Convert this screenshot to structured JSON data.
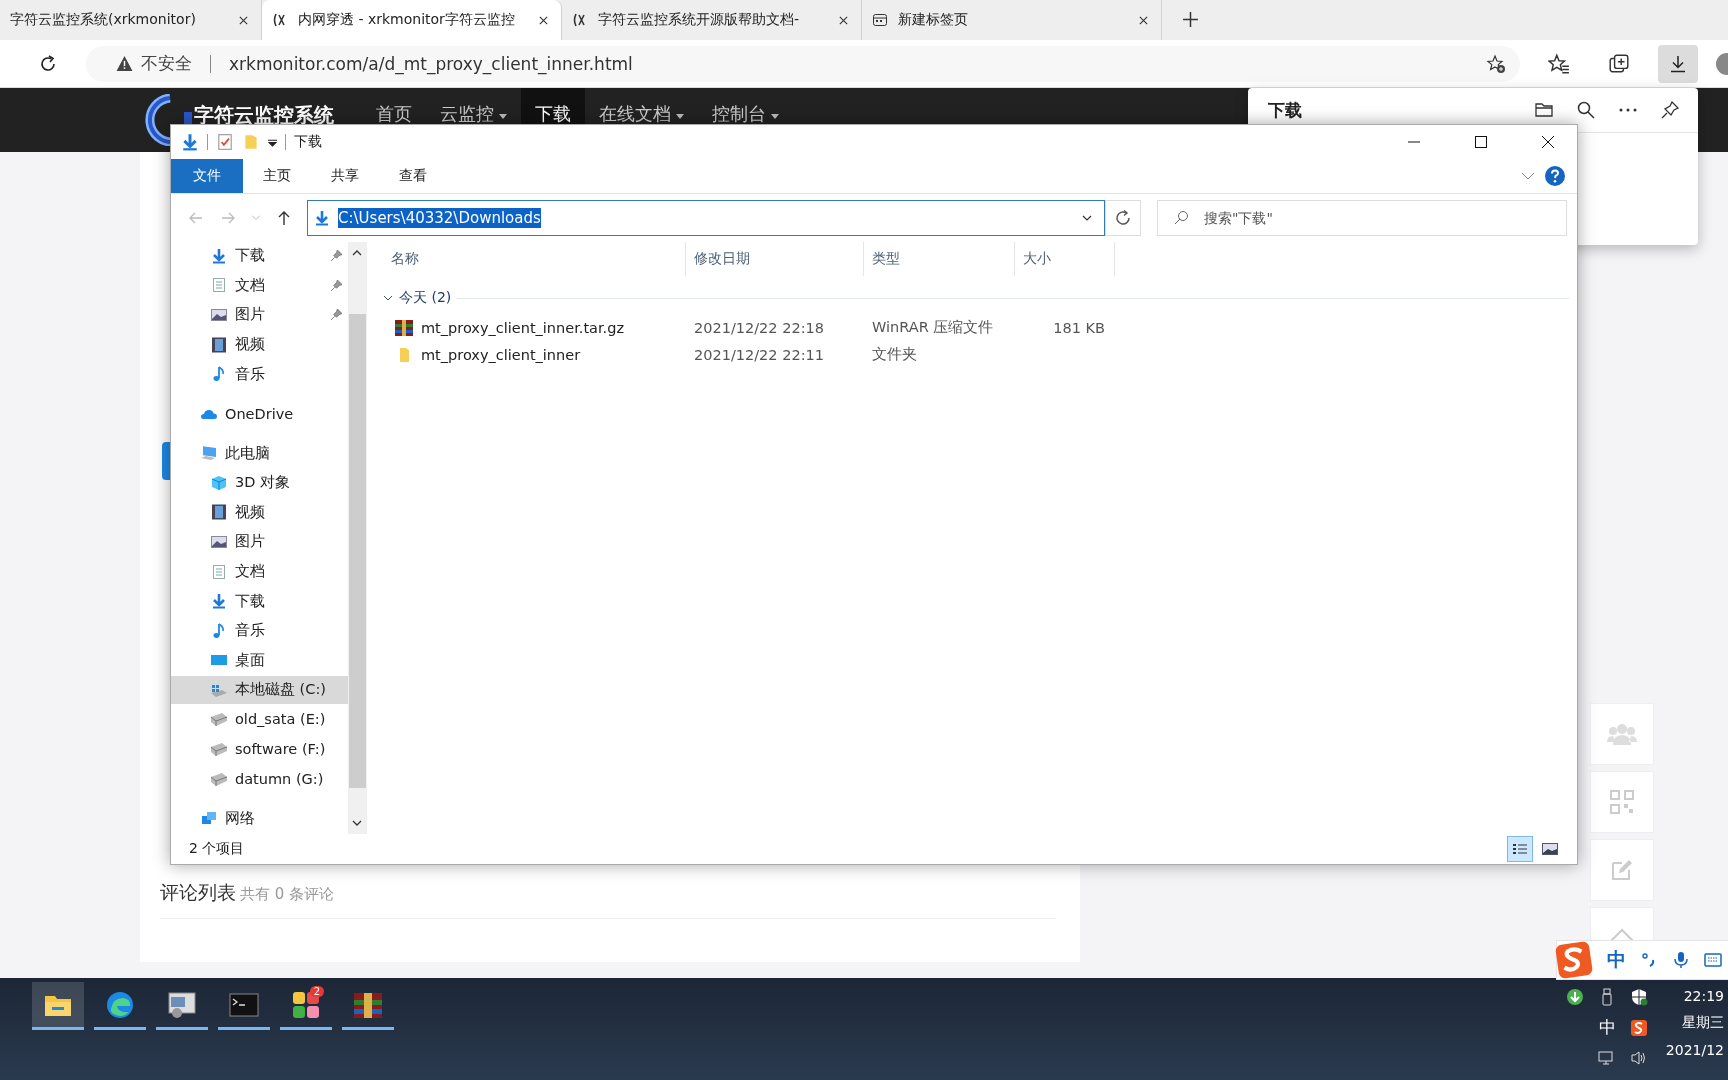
{
  "browser": {
    "tabs": [
      {
        "title": "字符云监控系统(xrkmonitor)",
        "selected": false,
        "kind": "plain"
      },
      {
        "title": "内网穿透 - xrkmonitor字符云监控",
        "selected": true,
        "kind": "site"
      },
      {
        "title": "字符云监控系统开源版帮助文档-",
        "selected": false,
        "kind": "site"
      },
      {
        "title": "新建标签页",
        "selected": false,
        "kind": "newtab"
      }
    ],
    "security": "不安全",
    "url": "xrkmonitor.com/a/d_mt_proxy_client_inner.html"
  },
  "site": {
    "logo": "字符云监控系统",
    "menu": [
      {
        "label": "首页",
        "selected": false,
        "dropdown": false
      },
      {
        "label": "云监控",
        "selected": false,
        "dropdown": true
      },
      {
        "label": "下载",
        "selected": true,
        "dropdown": false
      },
      {
        "label": "在线文档",
        "selected": false,
        "dropdown": true
      },
      {
        "label": "控制台",
        "selected": false,
        "dropdown": true
      }
    ],
    "comments_title": "评论列表",
    "comments_count": "共有 0 条评论"
  },
  "downloads_panel": {
    "title": "下载"
  },
  "explorer": {
    "title": "下载",
    "ribbon_tabs": [
      {
        "label": "文件",
        "selected": true
      },
      {
        "label": "主页",
        "selected": false
      },
      {
        "label": "共享",
        "selected": false
      },
      {
        "label": "查看",
        "selected": false
      }
    ],
    "address": "C:\\Users\\40332\\Downloads",
    "search_placeholder": "搜索\"下载\"",
    "quick_access": [
      {
        "label": "下载",
        "kind": "download",
        "pinned": true,
        "selected": false
      },
      {
        "label": "文档",
        "kind": "docs",
        "pinned": true,
        "selected": false
      },
      {
        "label": "图片",
        "kind": "pictures",
        "pinned": true,
        "selected": false
      },
      {
        "label": "视频",
        "kind": "video",
        "pinned": false,
        "selected": false
      },
      {
        "label": "音乐",
        "kind": "music",
        "pinned": false,
        "selected": false
      }
    ],
    "nav": [
      {
        "label": "OneDrive",
        "kind": "cloud",
        "selected": false
      },
      {
        "label": "此电脑",
        "kind": "pc",
        "selected": false,
        "children": [
          {
            "label": "3D 对象",
            "kind": "cube",
            "selected": false
          },
          {
            "label": "视频",
            "kind": "video",
            "selected": false
          },
          {
            "label": "图片",
            "kind": "pictures",
            "selected": false
          },
          {
            "label": "文档",
            "kind": "docs",
            "selected": false
          },
          {
            "label": "下载",
            "kind": "download",
            "selected": false
          },
          {
            "label": "音乐",
            "kind": "music",
            "selected": false
          },
          {
            "label": "桌面",
            "kind": "desktop",
            "selected": false
          },
          {
            "label": "本地磁盘 (C:)",
            "kind": "drive-win",
            "selected": true
          },
          {
            "label": "old_sata (E:)",
            "kind": "drive",
            "selected": false
          },
          {
            "label": "software (F:)",
            "kind": "drive",
            "selected": false
          },
          {
            "label": "datumn (G:)",
            "kind": "drive",
            "selected": false
          }
        ]
      },
      {
        "label": "网络",
        "kind": "network",
        "selected": false
      }
    ],
    "columns": [
      "名称",
      "修改日期",
      "类型",
      "大小"
    ],
    "group": "今天 (2)",
    "files": [
      {
        "name": "mt_proxy_client_inner.tar.gz",
        "date": "2021/12/22 22:18",
        "type": "WinRAR 压缩文件",
        "size": "181 KB",
        "kind": "archive"
      },
      {
        "name": "mt_proxy_client_inner",
        "date": "2021/12/22 22:11",
        "type": "文件夹",
        "kind": "folder"
      }
    ],
    "status": "2 个项目",
    "views": [
      {
        "kind": "details",
        "selected": true
      },
      {
        "kind": "thumbnails",
        "selected": false
      }
    ]
  },
  "ime_bar": {
    "mode": "中"
  },
  "taskbar": {
    "apps": [
      {
        "kind": "explorer",
        "selected": true
      },
      {
        "kind": "edge",
        "selected": false
      },
      {
        "kind": "app",
        "selected": false
      },
      {
        "kind": "terminal",
        "selected": false
      },
      {
        "kind": "tiles",
        "selected": false,
        "badge": "2"
      },
      {
        "kind": "winrar",
        "selected": false
      }
    ],
    "ime": "中",
    "time": "22:19",
    "weekday": "星期三",
    "date": "2021/12"
  }
}
